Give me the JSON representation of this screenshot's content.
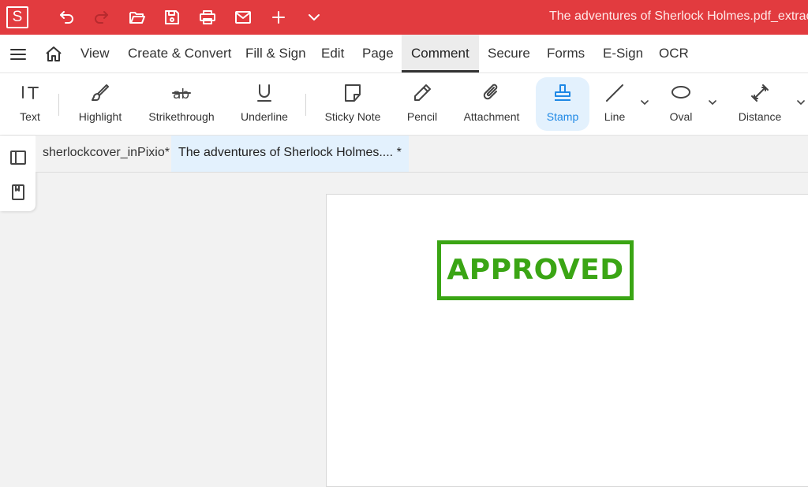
{
  "app": {
    "logo_letter": "S",
    "doc_title": "The adventures of Sherlock Holmes.pdf_extract"
  },
  "titlebar_icons": [
    "undo-icon",
    "redo-icon",
    "open-folder-icon",
    "save-icon",
    "print-icon",
    "email-icon",
    "plus-icon",
    "chevron-down-icon"
  ],
  "menu": {
    "items": [
      "View",
      "Create & Convert",
      "Fill & Sign",
      "Edit",
      "Page",
      "Comment",
      "Secure",
      "Forms",
      "E-Sign",
      "OCR"
    ],
    "active": "Comment"
  },
  "tools": {
    "text": "Text",
    "highlight": "Highlight",
    "strikethrough": "Strikethrough",
    "underline": "Underline",
    "sticky_note": "Sticky Note",
    "pencil": "Pencil",
    "attachment": "Attachment",
    "stamp": "Stamp",
    "line": "Line",
    "oval": "Oval",
    "distance": "Distance",
    "selected": "Stamp"
  },
  "tabs": [
    {
      "label": "sherlockcover_inPixio*"
    },
    {
      "label": "The adventures of Sherlock Holmes.... *"
    }
  ],
  "stamp": {
    "text": "APPROVED",
    "color": "#3aa514"
  },
  "colors": {
    "titlebar": "#e23b3f",
    "selected_blue": "#1e88e5"
  }
}
